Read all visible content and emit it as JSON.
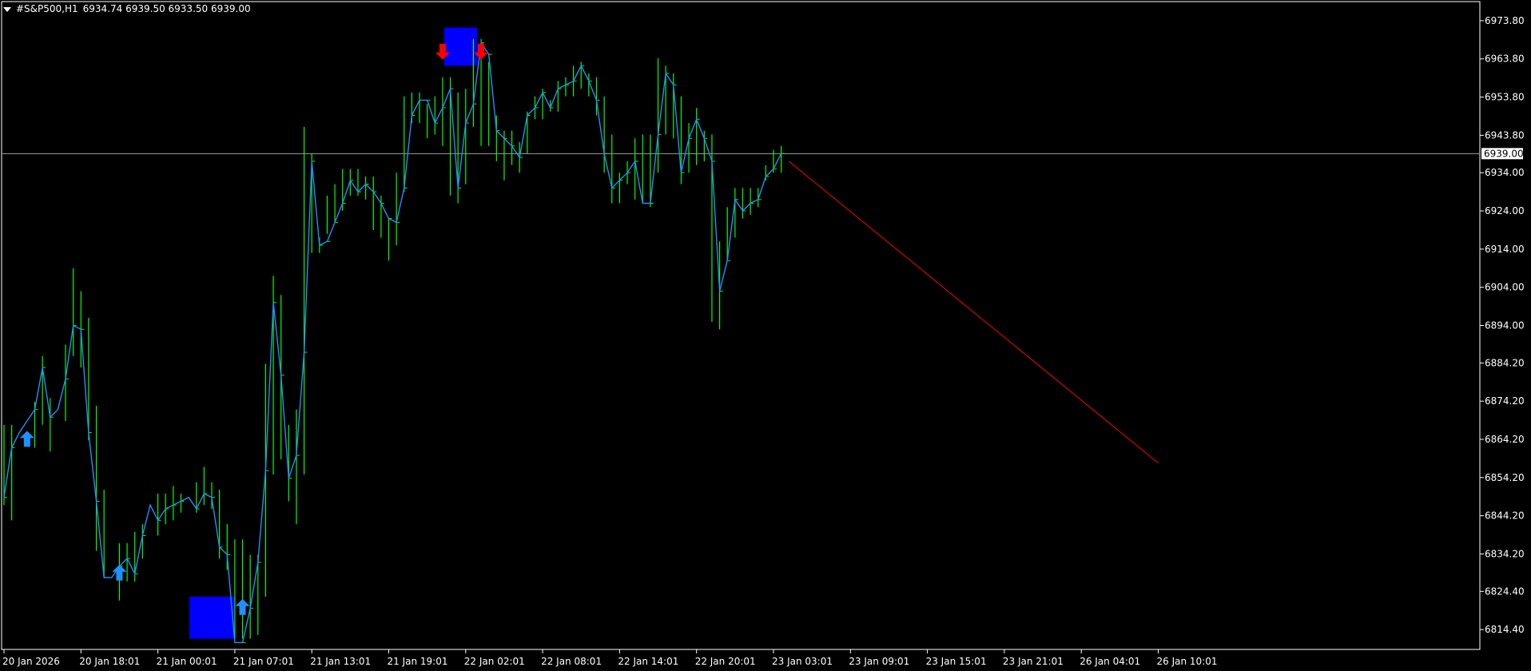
{
  "header": {
    "symbol": "#S&P500,H1",
    "ohlc": "6934.74 6939.50 6933.50 6939.00"
  },
  "colors": {
    "background": "#000000",
    "frame": "#FFFFFF",
    "bar": "#00FF00",
    "line": "#1E90FF",
    "price_line": "#A0A0A0",
    "box": "#0000FF",
    "buy_arrow": "#1E90FF",
    "sell_arrow": "#FF0000",
    "trend_line": "#FF0000"
  },
  "chart_data": {
    "type": "line",
    "ylim": [
      6809.2,
      6978.8
    ],
    "y_ticks": [
      "6973.80",
      "6963.80",
      "6953.80",
      "6943.80",
      "6934.00",
      "6924.00",
      "6914.00",
      "6904.00",
      "6894.00",
      "6884.20",
      "6874.20",
      "6864.20",
      "6854.20",
      "6844.20",
      "6834.20",
      "6824.40",
      "6814.40"
    ],
    "current_price_label": "6939.00",
    "current_price": 6939.0,
    "x_ticks": [
      {
        "label": "20 Jan 2026",
        "index": 0
      },
      {
        "label": "20 Jan 18:01",
        "index": 10
      },
      {
        "label": "21 Jan 00:01",
        "index": 20
      },
      {
        "label": "21 Jan 07:01",
        "index": 30
      },
      {
        "label": "21 Jan 13:01",
        "index": 40
      },
      {
        "label": "21 Jan 19:01",
        "index": 50
      },
      {
        "label": "22 Jan 02:01",
        "index": 60
      },
      {
        "label": "22 Jan 08:01",
        "index": 70
      },
      {
        "label": "22 Jan 14:01",
        "index": 80
      },
      {
        "label": "22 Jan 20:01",
        "index": 90
      },
      {
        "label": "23 Jan 03:01",
        "index": 100
      },
      {
        "label": "23 Jan 09:01",
        "index": 110
      },
      {
        "label": "23 Jan 15:01",
        "index": 120
      },
      {
        "label": "23 Jan 21:01",
        "index": 130
      },
      {
        "label": "26 Jan 04:01",
        "index": 140
      },
      {
        "label": "26 Jan 10:01",
        "index": 150
      }
    ],
    "close_values": [
      6849,
      6862,
      6866,
      6869,
      6872,
      6883,
      6870,
      6872,
      6880,
      6894,
      6893,
      6866,
      6848,
      6828,
      6828,
      6831,
      6833,
      6829,
      6839,
      6847,
      6843,
      6846,
      6847,
      6848,
      6849,
      6846,
      6850,
      6849,
      6836,
      6834,
      6811,
      6811,
      6820,
      6832,
      6856,
      6900,
      6881,
      6854,
      6860,
      6887,
      6937,
      6915,
      6916,
      6921,
      6926,
      6932,
      6929,
      6931,
      6929,
      6926,
      6922,
      6921,
      6930,
      6949,
      6953,
      6953,
      6947,
      6951,
      6956,
      6930,
      6947,
      6952,
      6968,
      6965,
      6945,
      6943,
      6941,
      6938,
      6949,
      6951,
      6955,
      6951,
      6956,
      6957,
      6958,
      6962,
      6958,
      6953,
      6939,
      6930,
      6932,
      6934,
      6937,
      6926,
      6926,
      6944,
      6960,
      6957,
      6934,
      6943,
      6948,
      6943,
      6937,
      6903,
      6911,
      6927,
      6924,
      6926,
      6927,
      6933,
      6935,
      6939
    ],
    "bars": [
      {
        "i": 0,
        "high": 6868,
        "low": 6847
      },
      {
        "i": 1,
        "high": 6868,
        "low": 6843
      },
      {
        "i": 4,
        "high": 6874,
        "low": 6862
      },
      {
        "i": 5,
        "high": 6886,
        "low": 6868
      },
      {
        "i": 6,
        "high": 6875,
        "low": 6861
      },
      {
        "i": 8,
        "high": 6889,
        "low": 6869
      },
      {
        "i": 9,
        "high": 6909,
        "low": 6886
      },
      {
        "i": 10,
        "high": 6903,
        "low": 6883
      },
      {
        "i": 11,
        "high": 6896,
        "low": 6864
      },
      {
        "i": 12,
        "high": 6873,
        "low": 6835
      },
      {
        "i": 13,
        "high": 6851,
        "low": 6828
      },
      {
        "i": 15,
        "high": 6837,
        "low": 6822
      },
      {
        "i": 16,
        "high": 6837,
        "low": 6827
      },
      {
        "i": 17,
        "high": 6840,
        "low": 6827
      },
      {
        "i": 18,
        "high": 6842,
        "low": 6833
      },
      {
        "i": 20,
        "high": 6850,
        "low": 6839
      },
      {
        "i": 21,
        "high": 6850,
        "low": 6842
      },
      {
        "i": 22,
        "high": 6852,
        "low": 6843
      },
      {
        "i": 23,
        "high": 6850,
        "low": 6845
      },
      {
        "i": 25,
        "high": 6853,
        "low": 6845
      },
      {
        "i": 26,
        "high": 6857,
        "low": 6847
      },
      {
        "i": 27,
        "high": 6853,
        "low": 6846
      },
      {
        "i": 28,
        "high": 6851,
        "low": 6833
      },
      {
        "i": 29,
        "high": 6842,
        "low": 6830
      },
      {
        "i": 30,
        "high": 6838,
        "low": 6812
      },
      {
        "i": 31,
        "high": 6838,
        "low": 6812
      },
      {
        "i": 32,
        "high": 6834,
        "low": 6812
      },
      {
        "i": 33,
        "high": 6834,
        "low": 6813
      },
      {
        "i": 34,
        "high": 6884,
        "low": 6823
      },
      {
        "i": 35,
        "high": 6907,
        "low": 6855
      },
      {
        "i": 36,
        "high": 6902,
        "low": 6859
      },
      {
        "i": 37,
        "high": 6868,
        "low": 6848
      },
      {
        "i": 38,
        "high": 6872,
        "low": 6842
      },
      {
        "i": 39,
        "high": 6946,
        "low": 6855
      },
      {
        "i": 40,
        "high": 6939,
        "low": 6913
      },
      {
        "i": 41,
        "high": 6917,
        "low": 6913
      },
      {
        "i": 42,
        "high": 6928,
        "low": 6918
      },
      {
        "i": 43,
        "high": 6931,
        "low": 6921
      },
      {
        "i": 44,
        "high": 6935,
        "low": 6924
      },
      {
        "i": 45,
        "high": 6935,
        "low": 6928
      },
      {
        "i": 46,
        "high": 6935,
        "low": 6928
      },
      {
        "i": 47,
        "high": 6933,
        "low": 6927
      },
      {
        "i": 48,
        "high": 6933,
        "low": 6919
      },
      {
        "i": 49,
        "high": 6928,
        "low": 6917
      },
      {
        "i": 50,
        "high": 6922,
        "low": 6911
      },
      {
        "i": 51,
        "high": 6934,
        "low": 6915
      },
      {
        "i": 52,
        "high": 6954,
        "low": 6929
      },
      {
        "i": 53,
        "high": 6955,
        "low": 6947
      },
      {
        "i": 54,
        "high": 6955,
        "low": 6947
      },
      {
        "i": 55,
        "high": 6952,
        "low": 6943
      },
      {
        "i": 56,
        "high": 6954,
        "low": 6944
      },
      {
        "i": 57,
        "high": 6959,
        "low": 6941
      },
      {
        "i": 58,
        "high": 6959,
        "low": 6928
      },
      {
        "i": 59,
        "high": 6955,
        "low": 6926
      },
      {
        "i": 60,
        "high": 6956,
        "low": 6931
      },
      {
        "i": 61,
        "high": 6969,
        "low": 6946
      },
      {
        "i": 62,
        "high": 6969,
        "low": 6941
      },
      {
        "i": 63,
        "high": 6963,
        "low": 6941
      },
      {
        "i": 64,
        "high": 6949,
        "low": 6937
      },
      {
        "i": 65,
        "high": 6945,
        "low": 6932
      },
      {
        "i": 66,
        "high": 6945,
        "low": 6936
      },
      {
        "i": 67,
        "high": 6942,
        "low": 6934
      },
      {
        "i": 68,
        "high": 6950,
        "low": 6939
      },
      {
        "i": 69,
        "high": 6954,
        "low": 6948
      },
      {
        "i": 70,
        "high": 6956,
        "low": 6948
      },
      {
        "i": 71,
        "high": 6953,
        "low": 6950
      },
      {
        "i": 72,
        "high": 6958,
        "low": 6950
      },
      {
        "i": 73,
        "high": 6959,
        "low": 6954
      },
      {
        "i": 74,
        "high": 6962,
        "low": 6954
      },
      {
        "i": 75,
        "high": 6963,
        "low": 6956
      },
      {
        "i": 76,
        "high": 6960,
        "low": 6954
      },
      {
        "i": 77,
        "high": 6959,
        "low": 6949
      },
      {
        "i": 78,
        "high": 6954,
        "low": 6934
      },
      {
        "i": 79,
        "high": 6944,
        "low": 6926
      },
      {
        "i": 80,
        "high": 6934,
        "low": 6926
      },
      {
        "i": 81,
        "high": 6937,
        "low": 6931
      },
      {
        "i": 82,
        "high": 6943,
        "low": 6927
      },
      {
        "i": 83,
        "high": 6944,
        "low": 6926
      },
      {
        "i": 84,
        "high": 6944,
        "low": 6925
      },
      {
        "i": 85,
        "high": 6964,
        "low": 6934
      },
      {
        "i": 86,
        "high": 6962,
        "low": 6944
      },
      {
        "i": 87,
        "high": 6960,
        "low": 6943
      },
      {
        "i": 88,
        "high": 6954,
        "low": 6931
      },
      {
        "i": 89,
        "high": 6947,
        "low": 6934
      },
      {
        "i": 90,
        "high": 6951,
        "low": 6936
      },
      {
        "i": 91,
        "high": 6945,
        "low": 6937
      },
      {
        "i": 92,
        "high": 6944,
        "low": 6895
      },
      {
        "i": 93,
        "high": 6916,
        "low": 6893
      },
      {
        "i": 94,
        "high": 6925,
        "low": 6911
      },
      {
        "i": 95,
        "high": 6930,
        "low": 6917
      },
      {
        "i": 96,
        "high": 6930,
        "low": 6922
      },
      {
        "i": 97,
        "high": 6930,
        "low": 6923
      },
      {
        "i": 98,
        "high": 6930,
        "low": 6925
      },
      {
        "i": 99,
        "high": 6936,
        "low": 6932
      },
      {
        "i": 100,
        "high": 6940,
        "low": 6934
      },
      {
        "i": 101,
        "high": 6941,
        "low": 6934
      }
    ],
    "signal_boxes": [
      {
        "name": "low-box",
        "x_from": 24.1,
        "x_to": 29.9,
        "y_low": 6812,
        "y_high": 6823
      },
      {
        "name": "high-box",
        "x_from": 57.2,
        "x_to": 61.5,
        "y_low": 6962,
        "y_high": 6972
      }
    ],
    "arrows": [
      {
        "type": "buy",
        "index": 3,
        "value": 6866
      },
      {
        "type": "buy",
        "index": 15,
        "value": 6831
      },
      {
        "type": "buy",
        "index": 31,
        "value": 6822
      },
      {
        "type": "sell",
        "index": 57,
        "value": 6964
      },
      {
        "type": "sell",
        "index": 62,
        "value": 6964
      }
    ],
    "trend_line": {
      "x_from": 102,
      "y_from": 6937,
      "x_to": 150,
      "y_to": 6858
    }
  }
}
